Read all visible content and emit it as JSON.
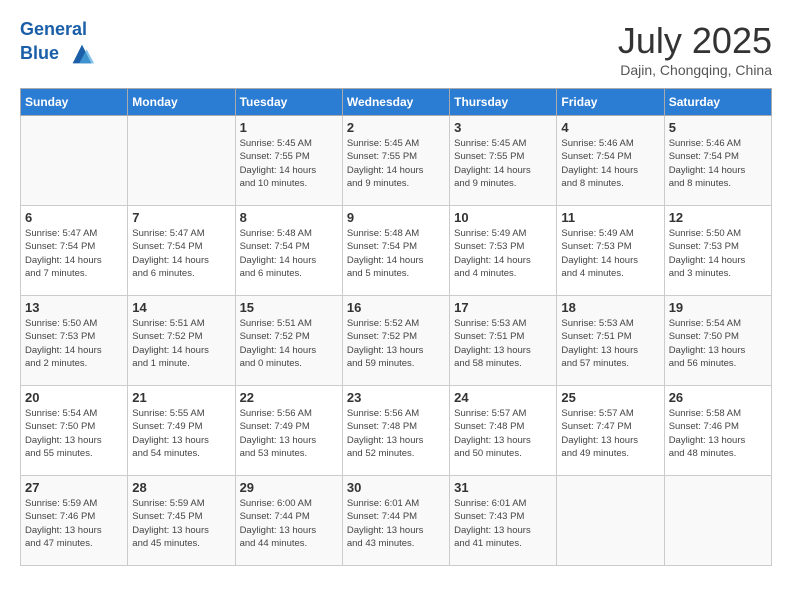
{
  "header": {
    "logo_line1": "General",
    "logo_line2": "Blue",
    "month": "July 2025",
    "location": "Dajin, Chongqing, China"
  },
  "weekdays": [
    "Sunday",
    "Monday",
    "Tuesday",
    "Wednesday",
    "Thursday",
    "Friday",
    "Saturday"
  ],
  "weeks": [
    [
      {
        "day": "",
        "info": ""
      },
      {
        "day": "",
        "info": ""
      },
      {
        "day": "1",
        "info": "Sunrise: 5:45 AM\nSunset: 7:55 PM\nDaylight: 14 hours\nand 10 minutes."
      },
      {
        "day": "2",
        "info": "Sunrise: 5:45 AM\nSunset: 7:55 PM\nDaylight: 14 hours\nand 9 minutes."
      },
      {
        "day": "3",
        "info": "Sunrise: 5:45 AM\nSunset: 7:55 PM\nDaylight: 14 hours\nand 9 minutes."
      },
      {
        "day": "4",
        "info": "Sunrise: 5:46 AM\nSunset: 7:54 PM\nDaylight: 14 hours\nand 8 minutes."
      },
      {
        "day": "5",
        "info": "Sunrise: 5:46 AM\nSunset: 7:54 PM\nDaylight: 14 hours\nand 8 minutes."
      }
    ],
    [
      {
        "day": "6",
        "info": "Sunrise: 5:47 AM\nSunset: 7:54 PM\nDaylight: 14 hours\nand 7 minutes."
      },
      {
        "day": "7",
        "info": "Sunrise: 5:47 AM\nSunset: 7:54 PM\nDaylight: 14 hours\nand 6 minutes."
      },
      {
        "day": "8",
        "info": "Sunrise: 5:48 AM\nSunset: 7:54 PM\nDaylight: 14 hours\nand 6 minutes."
      },
      {
        "day": "9",
        "info": "Sunrise: 5:48 AM\nSunset: 7:54 PM\nDaylight: 14 hours\nand 5 minutes."
      },
      {
        "day": "10",
        "info": "Sunrise: 5:49 AM\nSunset: 7:53 PM\nDaylight: 14 hours\nand 4 minutes."
      },
      {
        "day": "11",
        "info": "Sunrise: 5:49 AM\nSunset: 7:53 PM\nDaylight: 14 hours\nand 4 minutes."
      },
      {
        "day": "12",
        "info": "Sunrise: 5:50 AM\nSunset: 7:53 PM\nDaylight: 14 hours\nand 3 minutes."
      }
    ],
    [
      {
        "day": "13",
        "info": "Sunrise: 5:50 AM\nSunset: 7:53 PM\nDaylight: 14 hours\nand 2 minutes."
      },
      {
        "day": "14",
        "info": "Sunrise: 5:51 AM\nSunset: 7:52 PM\nDaylight: 14 hours\nand 1 minute."
      },
      {
        "day": "15",
        "info": "Sunrise: 5:51 AM\nSunset: 7:52 PM\nDaylight: 14 hours\nand 0 minutes."
      },
      {
        "day": "16",
        "info": "Sunrise: 5:52 AM\nSunset: 7:52 PM\nDaylight: 13 hours\nand 59 minutes."
      },
      {
        "day": "17",
        "info": "Sunrise: 5:53 AM\nSunset: 7:51 PM\nDaylight: 13 hours\nand 58 minutes."
      },
      {
        "day": "18",
        "info": "Sunrise: 5:53 AM\nSunset: 7:51 PM\nDaylight: 13 hours\nand 57 minutes."
      },
      {
        "day": "19",
        "info": "Sunrise: 5:54 AM\nSunset: 7:50 PM\nDaylight: 13 hours\nand 56 minutes."
      }
    ],
    [
      {
        "day": "20",
        "info": "Sunrise: 5:54 AM\nSunset: 7:50 PM\nDaylight: 13 hours\nand 55 minutes."
      },
      {
        "day": "21",
        "info": "Sunrise: 5:55 AM\nSunset: 7:49 PM\nDaylight: 13 hours\nand 54 minutes."
      },
      {
        "day": "22",
        "info": "Sunrise: 5:56 AM\nSunset: 7:49 PM\nDaylight: 13 hours\nand 53 minutes."
      },
      {
        "day": "23",
        "info": "Sunrise: 5:56 AM\nSunset: 7:48 PM\nDaylight: 13 hours\nand 52 minutes."
      },
      {
        "day": "24",
        "info": "Sunrise: 5:57 AM\nSunset: 7:48 PM\nDaylight: 13 hours\nand 50 minutes."
      },
      {
        "day": "25",
        "info": "Sunrise: 5:57 AM\nSunset: 7:47 PM\nDaylight: 13 hours\nand 49 minutes."
      },
      {
        "day": "26",
        "info": "Sunrise: 5:58 AM\nSunset: 7:46 PM\nDaylight: 13 hours\nand 48 minutes."
      }
    ],
    [
      {
        "day": "27",
        "info": "Sunrise: 5:59 AM\nSunset: 7:46 PM\nDaylight: 13 hours\nand 47 minutes."
      },
      {
        "day": "28",
        "info": "Sunrise: 5:59 AM\nSunset: 7:45 PM\nDaylight: 13 hours\nand 45 minutes."
      },
      {
        "day": "29",
        "info": "Sunrise: 6:00 AM\nSunset: 7:44 PM\nDaylight: 13 hours\nand 44 minutes."
      },
      {
        "day": "30",
        "info": "Sunrise: 6:01 AM\nSunset: 7:44 PM\nDaylight: 13 hours\nand 43 minutes."
      },
      {
        "day": "31",
        "info": "Sunrise: 6:01 AM\nSunset: 7:43 PM\nDaylight: 13 hours\nand 41 minutes."
      },
      {
        "day": "",
        "info": ""
      },
      {
        "day": "",
        "info": ""
      }
    ]
  ]
}
